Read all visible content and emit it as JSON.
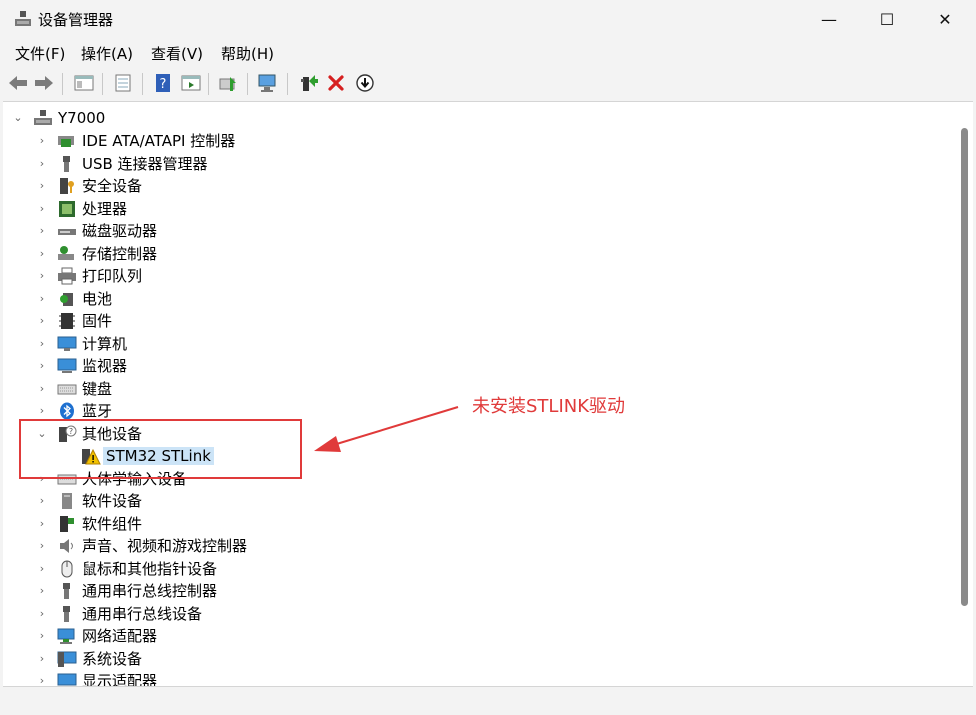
{
  "window": {
    "title": "设备管理器",
    "minimize": "—",
    "maximize": "☐",
    "close": "✕"
  },
  "menu": [
    "文件(F)",
    "操作(A)",
    "查看(V)",
    "帮助(H)"
  ],
  "tree": {
    "root": "Y7000",
    "items": [
      "IDE ATA/ATAPI 控制器",
      "USB 连接器管理器",
      "安全设备",
      "处理器",
      "磁盘驱动器",
      "存储控制器",
      "打印队列",
      "电池",
      "固件",
      "计算机",
      "监视器",
      "键盘",
      "蓝牙",
      "其他设备",
      "STM32 STLink",
      "人体学输入设备",
      "软件设备",
      "软件组件",
      "声音、视频和游戏控制器",
      "鼠标和其他指针设备",
      "通用串行总线控制器",
      "通用串行总线设备",
      "网络适配器",
      "系统设备",
      "显示适配器"
    ]
  },
  "annotation": {
    "text": "未安装STLINK驱动",
    "color": "#e03a3a"
  },
  "colors": {
    "selection": "#cce4f7",
    "accent": "#e03a3a"
  }
}
